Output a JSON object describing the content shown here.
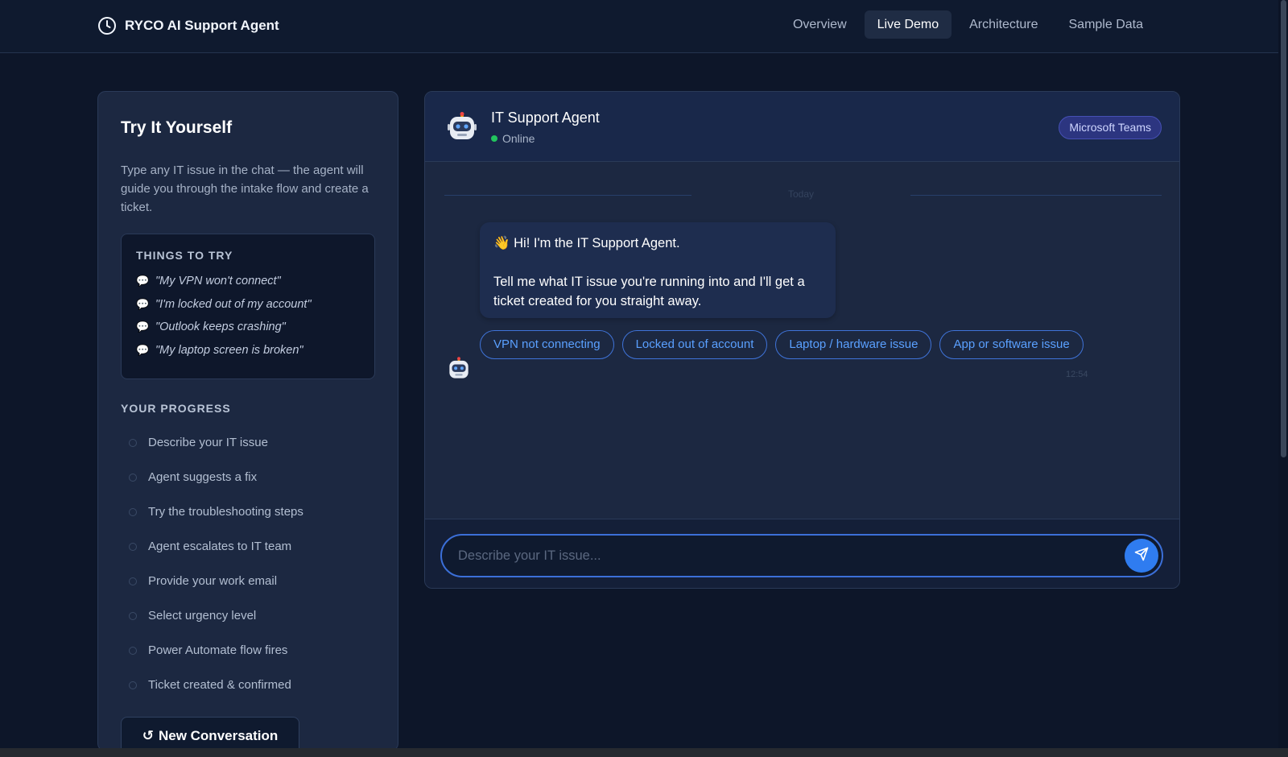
{
  "app": {
    "title": "RYCO AI Support Agent"
  },
  "nav": {
    "items": [
      {
        "label": "Overview",
        "active": false
      },
      {
        "label": "Live Demo",
        "active": true
      },
      {
        "label": "Architecture",
        "active": false
      },
      {
        "label": "Sample Data",
        "active": false
      }
    ]
  },
  "sidebar": {
    "title": "Try It Yourself",
    "description": "Type any IT issue in the chat — the agent will guide you through the intake flow and create a ticket.",
    "tips": {
      "header": "THINGS TO TRY",
      "icon": "💬",
      "items": [
        "\"My VPN won't connect\"",
        "\"I'm locked out of my account\"",
        "\"Outlook keeps crashing\"",
        "\"My laptop screen is broken\""
      ]
    },
    "progress": {
      "header": "YOUR PROGRESS",
      "steps": [
        "Describe your IT issue",
        "Agent suggests a fix",
        "Try the troubleshooting steps",
        "Agent escalates to IT team",
        "Provide your work email",
        "Select urgency level",
        "Power Automate flow fires",
        "Ticket created & confirmed"
      ]
    },
    "new_conversation": {
      "icon": "↺",
      "label": "New Conversation"
    }
  },
  "chat": {
    "agent_name": "IT Support Agent",
    "status": "Online",
    "badge": "Microsoft Teams",
    "divider": "Today",
    "message": {
      "line1": "👋 Hi! I'm the IT Support Agent.",
      "line2": "Tell me what IT issue you're running into and I'll get a ticket created for you straight away.",
      "time": "12:54"
    },
    "quick_replies": [
      "VPN not connecting",
      "Locked out of account",
      "Laptop / hardware issue",
      "App or software issue"
    ],
    "input": {
      "placeholder": "Describe your IT issue...",
      "value": ""
    }
  },
  "colors": {
    "background": "#0d1629",
    "panel": "#1c2841",
    "accent": "#2f7cf0",
    "status_online": "#22c55e",
    "badge": "#2c3580"
  }
}
